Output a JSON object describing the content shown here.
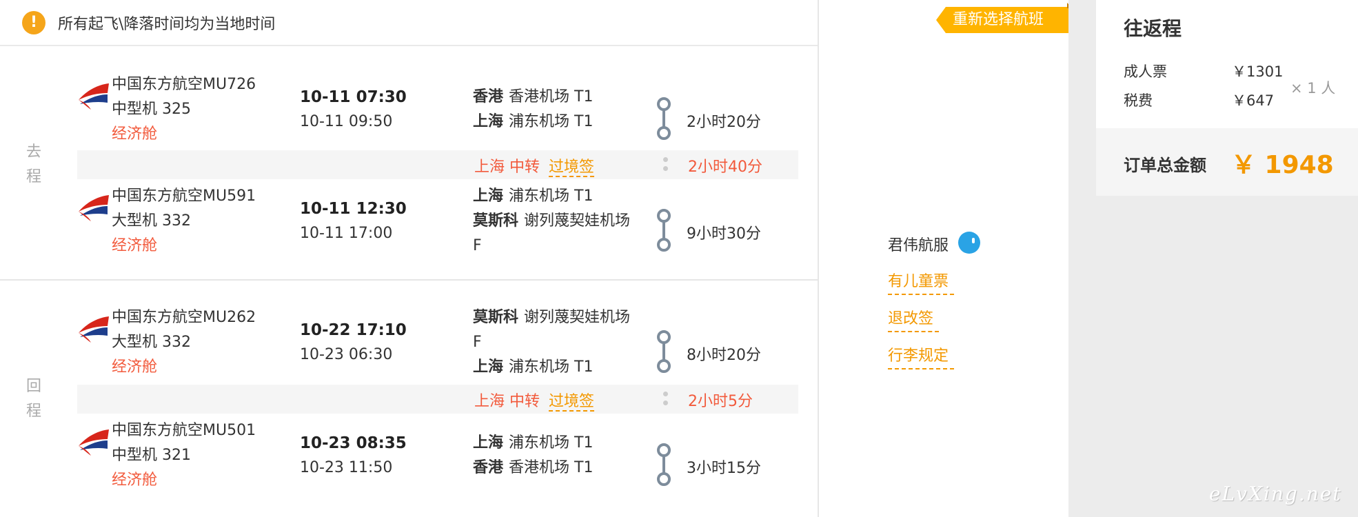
{
  "notice": {
    "icon": "!",
    "text": "所有起飞\\降落时间均为当地时间"
  },
  "outbound": {
    "label": "去程",
    "segments": [
      {
        "airline": "中国东方航空MU726",
        "aircraft": "中型机 325",
        "cabin": "经济舱",
        "dep_time": "10-11 07:30",
        "arr_time": "10-11 09:50",
        "dep_city": "香港",
        "dep_airport": "香港机场 T1",
        "arr_city": "上海",
        "arr_airport": "浦东机场 T1",
        "duration": "2小时20分"
      },
      {
        "airline": "中国东方航空MU591",
        "aircraft": "大型机 332",
        "cabin": "经济舱",
        "dep_time": "10-11 12:30",
        "arr_time": "10-11 17:00",
        "dep_city": "上海",
        "dep_airport": "浦东机场 T1",
        "arr_city": "莫斯科",
        "arr_airport": "谢列蔑契娃机场 F",
        "duration": "9小时30分"
      }
    ],
    "transfer": {
      "city": "上海",
      "text": "中转",
      "visa": "过境签",
      "duration": "2小时40分"
    }
  },
  "return": {
    "label": "回程",
    "segments": [
      {
        "airline": "中国东方航空MU262",
        "aircraft": "大型机 332",
        "cabin": "经济舱",
        "dep_time": "10-22 17:10",
        "arr_time": "10-23 06:30",
        "dep_city": "莫斯科",
        "dep_airport": "谢列蔑契娃机场 F",
        "arr_city": "上海",
        "arr_airport": "浦东机场 T1",
        "duration": "8小时20分"
      },
      {
        "airline": "中国东方航空MU501",
        "aircraft": "中型机 321",
        "cabin": "经济舱",
        "dep_time": "10-23 08:35",
        "arr_time": "10-23 11:50",
        "dep_city": "上海",
        "dep_airport": "浦东机场 T1",
        "arr_city": "香港",
        "arr_airport": "香港机场 T1",
        "duration": "3小时15分"
      }
    ],
    "transfer": {
      "city": "上海",
      "text": "中转",
      "visa": "过境签",
      "duration": "2小时5分"
    }
  },
  "side": {
    "reselect": "重新选择航班",
    "service": "君伟航服",
    "links": [
      "有儿童票",
      "退改签",
      "行李规定"
    ]
  },
  "price": {
    "title": "往返程",
    "adult_label": "成人票",
    "adult_value": "￥1301",
    "tax_label": "税费",
    "tax_value": "￥647",
    "multiplier": "× 1 人",
    "total_label": "订单总金额",
    "total_value": "￥ 1948"
  },
  "watermark": "eLvXing.net",
  "colors": {
    "accent": "#f39800",
    "cabin": "#f25a3c",
    "reselect": "#ffb400",
    "service_icon": "#2aa3e5",
    "airline_red": "#d7261b",
    "airline_blue": "#1e3e8c"
  }
}
